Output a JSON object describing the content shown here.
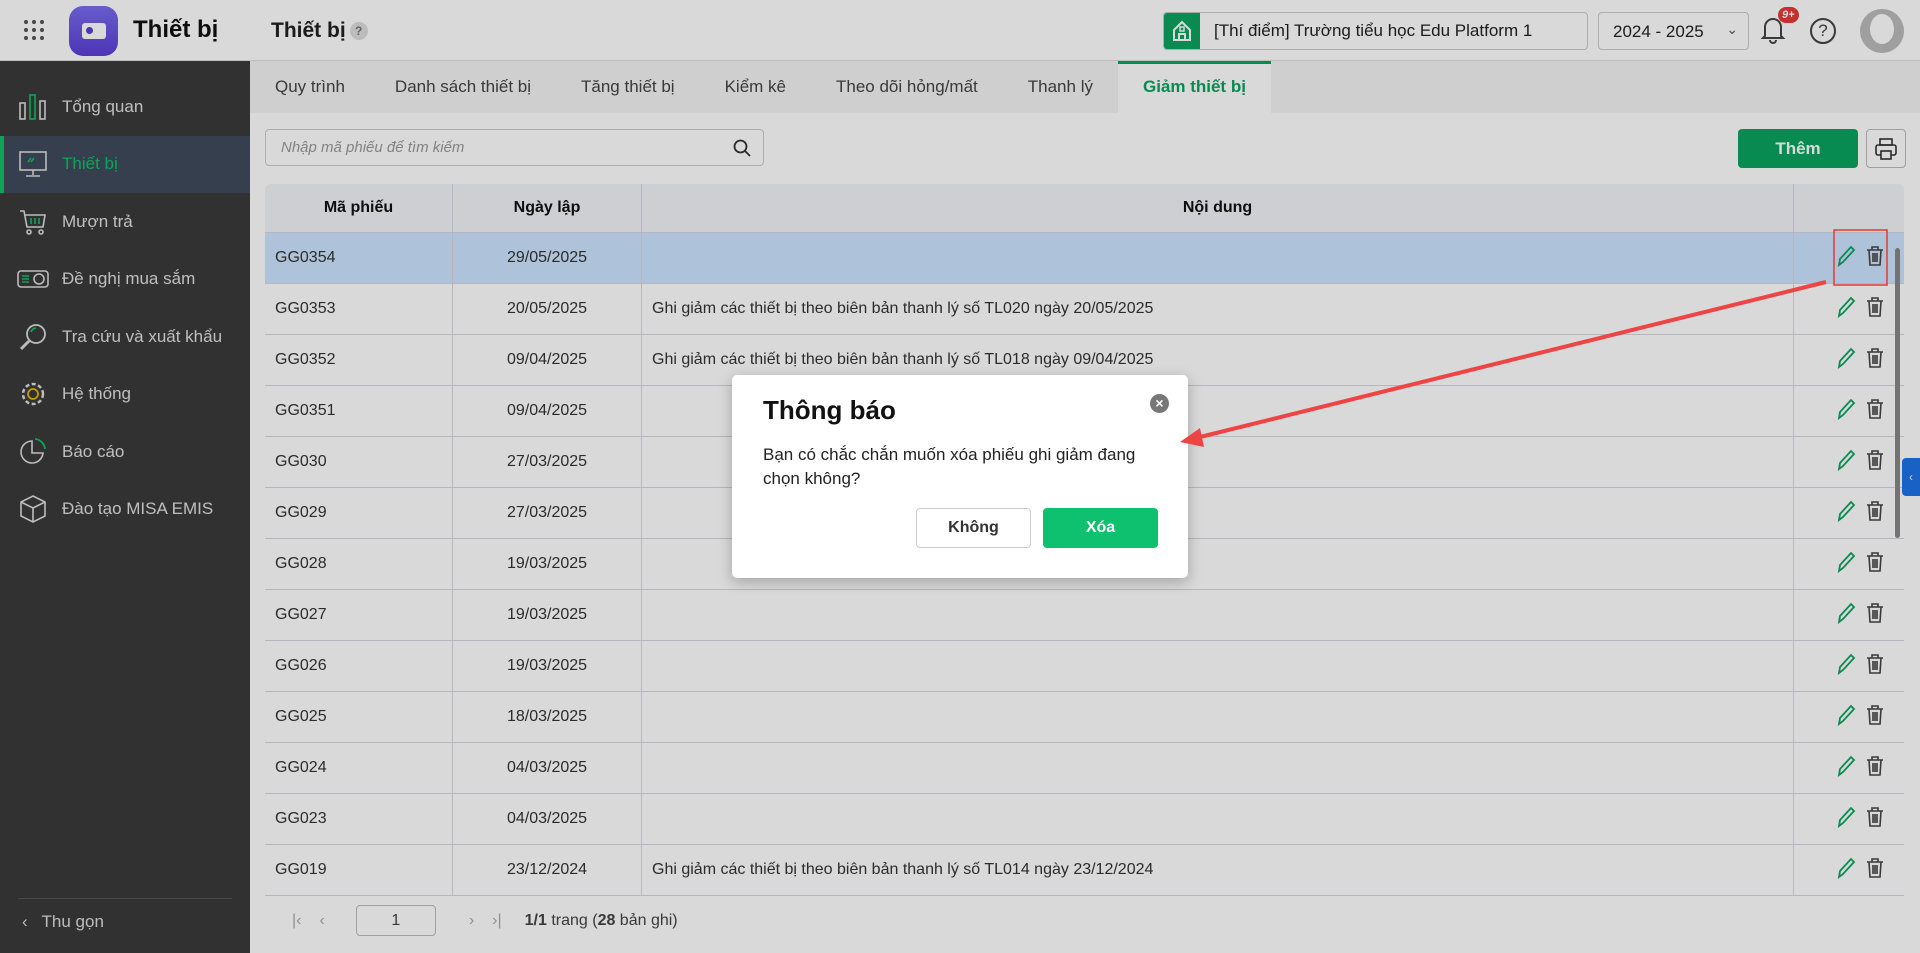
{
  "header": {
    "app_title": "Thiết bị",
    "page_title": "Thiết bị",
    "help_mark": "?",
    "school": "[Thí điểm] Trường tiểu học Edu Platform 1",
    "year": "2024 - 2025",
    "notification_count": "9+"
  },
  "sidebar": {
    "items": [
      {
        "label": "Tổng quan",
        "icon": "bar-chart-icon"
      },
      {
        "label": "Thiết bị",
        "icon": "monitor-icon",
        "active": true
      },
      {
        "label": "Mượn trả",
        "icon": "cart-icon"
      },
      {
        "label": "Đề nghị mua sắm",
        "icon": "projector-icon"
      },
      {
        "label": "Tra cứu và xuất khẩu",
        "icon": "search-icon"
      },
      {
        "label": "Hệ thống",
        "icon": "gear-icon"
      },
      {
        "label": "Báo cáo",
        "icon": "pie-chart-icon"
      },
      {
        "label": "Đào tạo MISA EMIS",
        "icon": "box-icon"
      }
    ],
    "collapse_label": "Thu gọn"
  },
  "tabs": [
    "Quy trình",
    "Danh sách thiết bị",
    "Tăng thiết bị",
    "Kiểm kê",
    "Theo dõi hỏng/mất",
    "Thanh lý",
    "Giảm thiết bị"
  ],
  "active_tab": 6,
  "toolbar": {
    "search_placeholder": "Nhập mã phiếu để tìm kiếm",
    "add_label": "Thêm"
  },
  "table": {
    "columns": [
      "Mã phiếu",
      "Ngày lập",
      "Nội dung"
    ],
    "rows": [
      [
        "GG0354",
        "29/05/2025",
        ""
      ],
      [
        "GG0353",
        "20/05/2025",
        "Ghi giảm các thiết bị theo biên bản thanh lý số TL020 ngày 20/05/2025"
      ],
      [
        "GG0352",
        "09/04/2025",
        "Ghi giảm các thiết bị theo biên bản thanh lý số TL018 ngày 09/04/2025"
      ],
      [
        "GG0351",
        "09/04/2025",
        ""
      ],
      [
        "GG030",
        "27/03/2025",
        ""
      ],
      [
        "GG029",
        "27/03/2025",
        ""
      ],
      [
        "GG028",
        "19/03/2025",
        ""
      ],
      [
        "GG027",
        "19/03/2025",
        ""
      ],
      [
        "GG026",
        "19/03/2025",
        ""
      ],
      [
        "GG025",
        "18/03/2025",
        ""
      ],
      [
        "GG024",
        "04/03/2025",
        ""
      ],
      [
        "GG023",
        "04/03/2025",
        ""
      ],
      [
        "GG019",
        "23/12/2024",
        "Ghi giảm các thiết bị theo biên bản thanh lý số TL014 ngày 23/12/2024"
      ]
    ],
    "selected_row": 0
  },
  "pagination": {
    "page": "1",
    "pages": "1/1",
    "trang": " trang (",
    "total": "28",
    "records": " bản ghi)"
  },
  "dialog": {
    "title": "Thông báo",
    "message": "Bạn có chắc chắn muốn xóa phiếu ghi giảm đang chọn không?",
    "cancel": "Không",
    "confirm": "Xóa"
  },
  "colors": {
    "accent": "#0aa45e",
    "annotation": "#e53935"
  }
}
